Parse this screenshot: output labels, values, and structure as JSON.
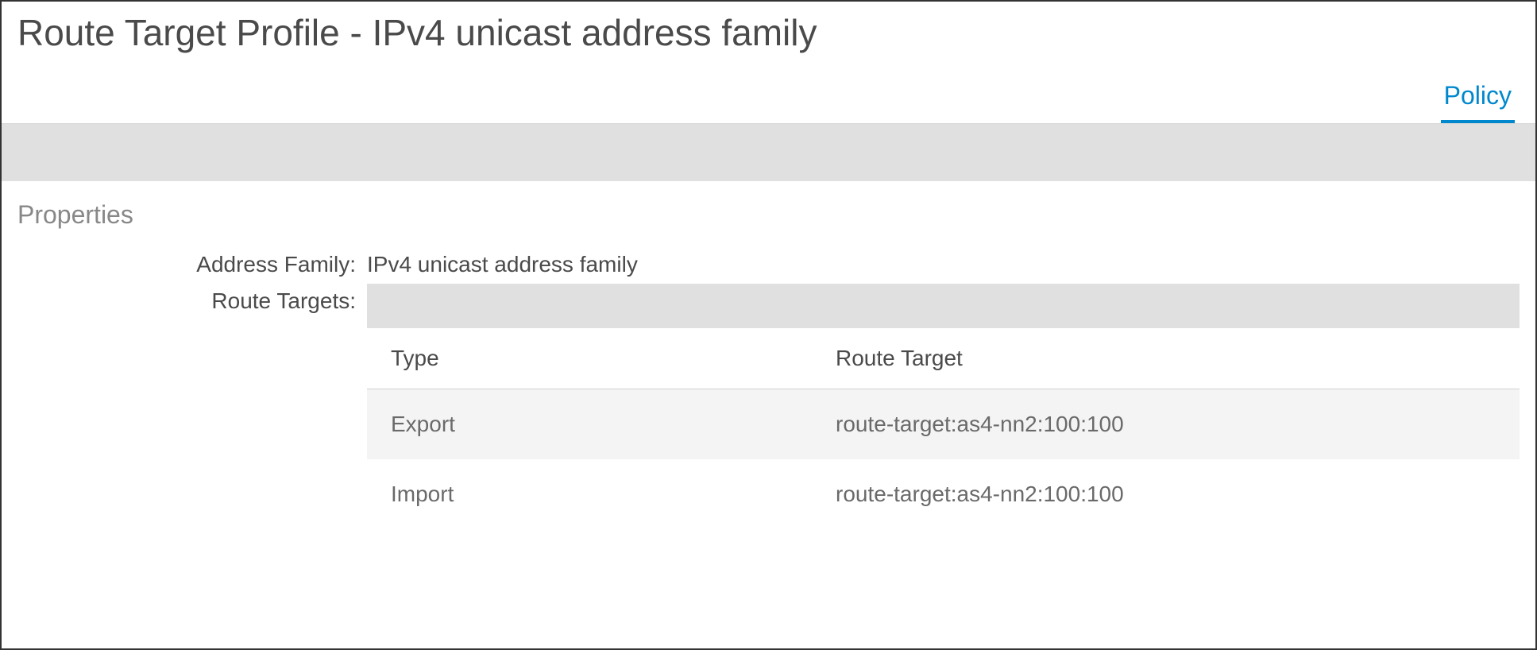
{
  "header": {
    "title": "Route Target Profile - IPv4 unicast address family"
  },
  "tabs": {
    "policy_label": "Policy"
  },
  "properties": {
    "section_title": "Properties",
    "address_family_label": "Address Family:",
    "address_family_value": "IPv4 unicast address family",
    "route_targets_label": "Route Targets:",
    "table": {
      "headers": {
        "type": "Type",
        "route_target": "Route Target"
      },
      "rows": [
        {
          "type": "Export",
          "route_target": "route-target:as4-nn2:100:100"
        },
        {
          "type": "Import",
          "route_target": "route-target:as4-nn2:100:100"
        }
      ]
    }
  }
}
